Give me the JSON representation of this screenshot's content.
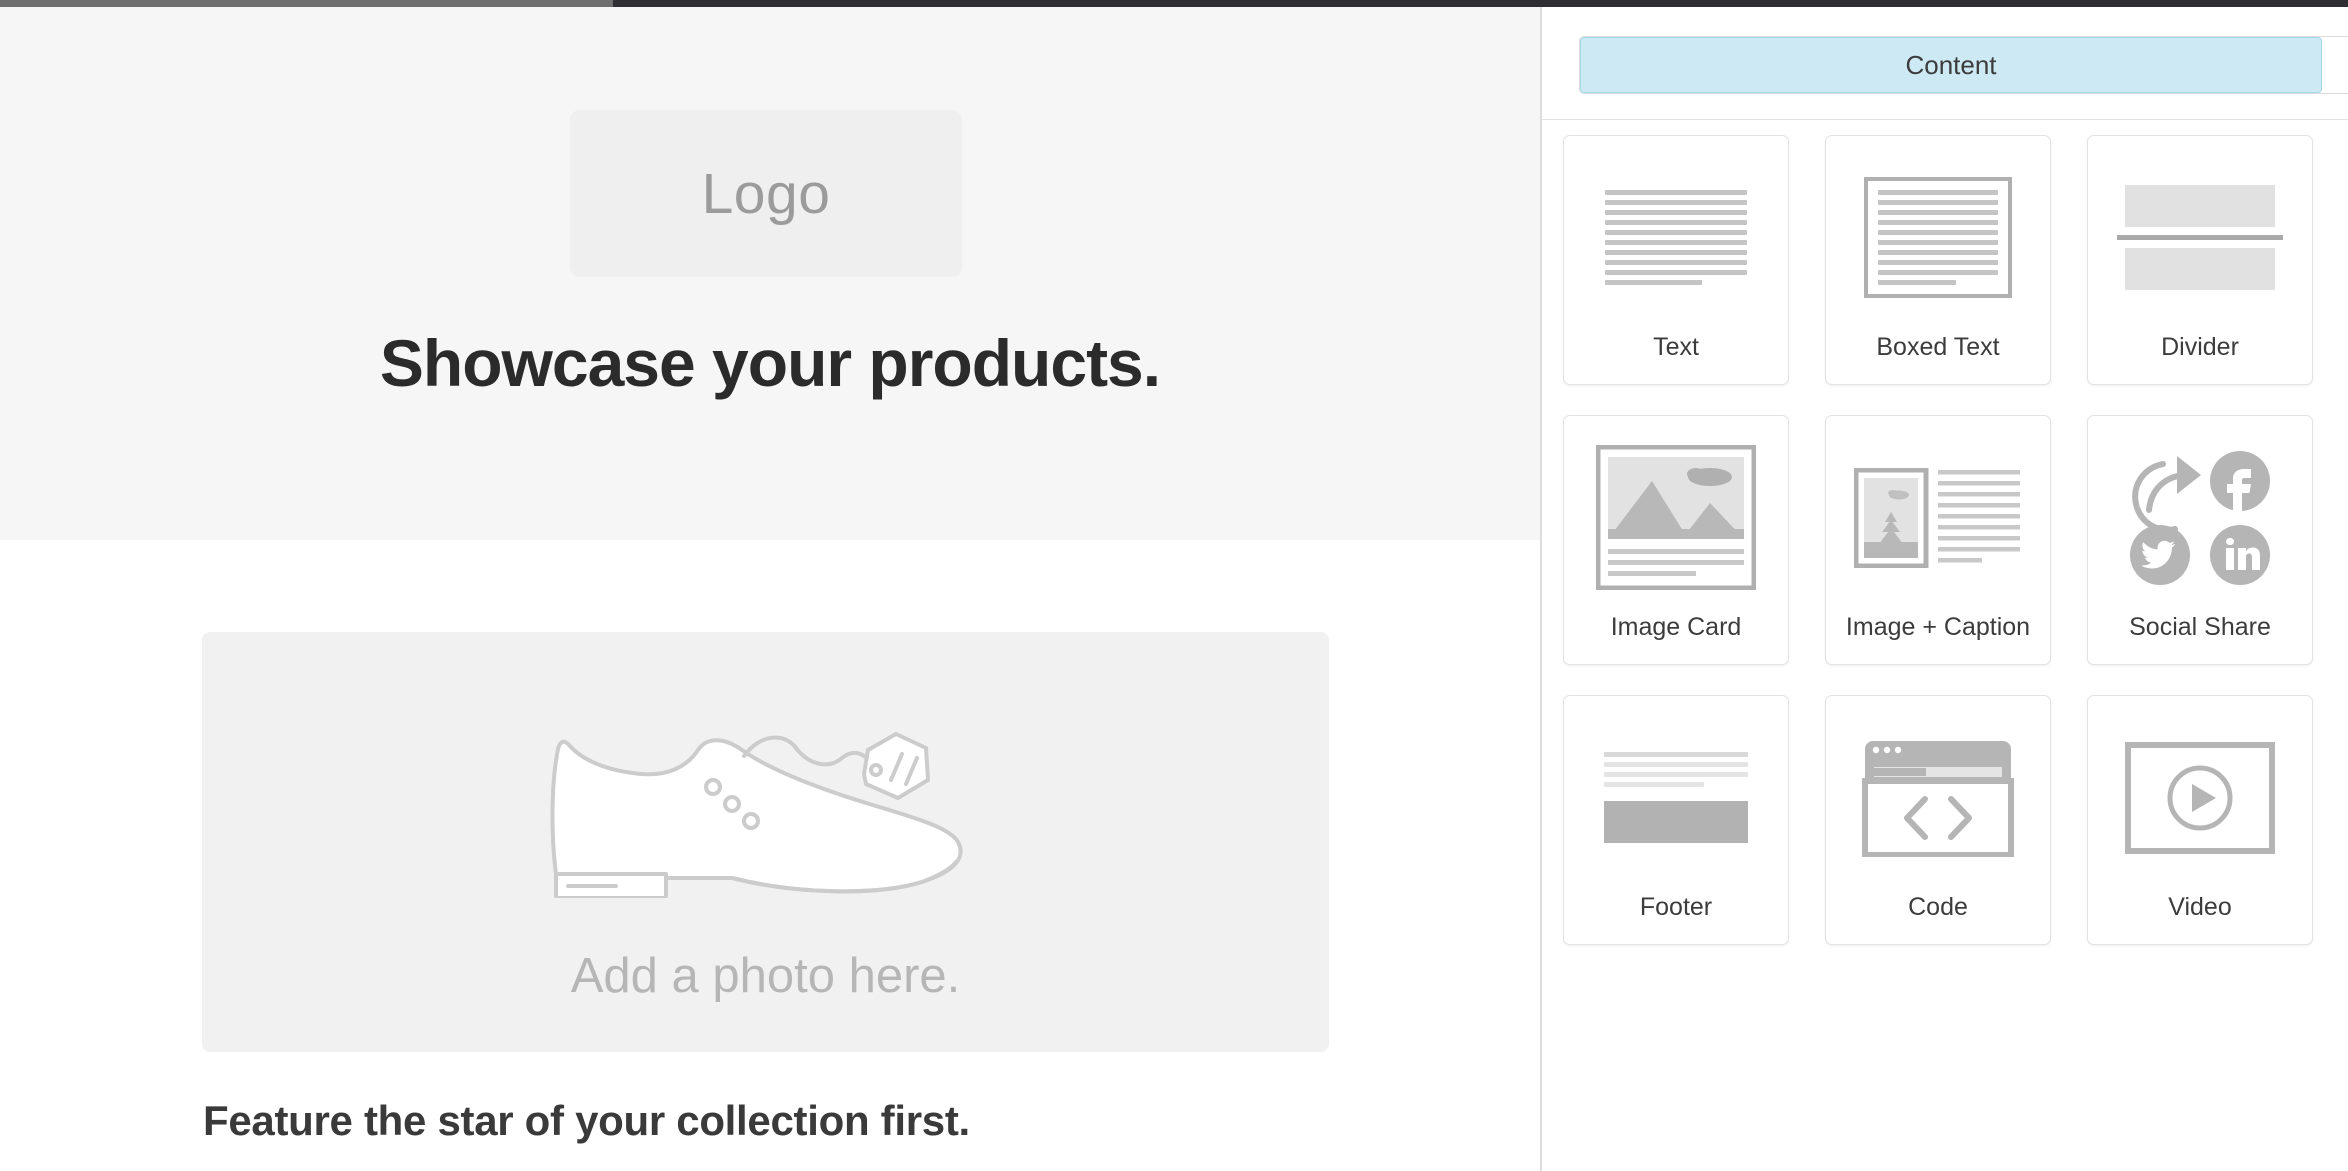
{
  "preview": {
    "logo_placeholder": "Logo",
    "hero_headline": "Showcase your products.",
    "photo_cta": "Add a photo here.",
    "feature_headline": "Feature the star of your collection first.",
    "shoe_illustration_icon": "dress-shoe-illustration",
    "hero_background": "#f6f6f6",
    "photo_block_background": "#f1f1f1"
  },
  "sidebar": {
    "tabs": [
      {
        "label": "Content",
        "active": true
      },
      {
        "label": "",
        "active": false
      }
    ],
    "active_tab_color": "#cdeaf4",
    "blocks": [
      {
        "label": "Text",
        "icon": "text-lines-icon"
      },
      {
        "label": "Boxed Text",
        "icon": "boxed-text-icon"
      },
      {
        "label": "Divider",
        "icon": "divider-icon"
      },
      {
        "label": "Image Card",
        "icon": "image-card-icon"
      },
      {
        "label": "Image + Caption",
        "icon": "image-caption-icon"
      },
      {
        "label": "Social Share",
        "icon": "social-share-icon"
      },
      {
        "label": "Footer",
        "icon": "footer-icon"
      },
      {
        "label": "Code",
        "icon": "code-window-icon"
      },
      {
        "label": "Video",
        "icon": "video-play-icon"
      }
    ]
  }
}
